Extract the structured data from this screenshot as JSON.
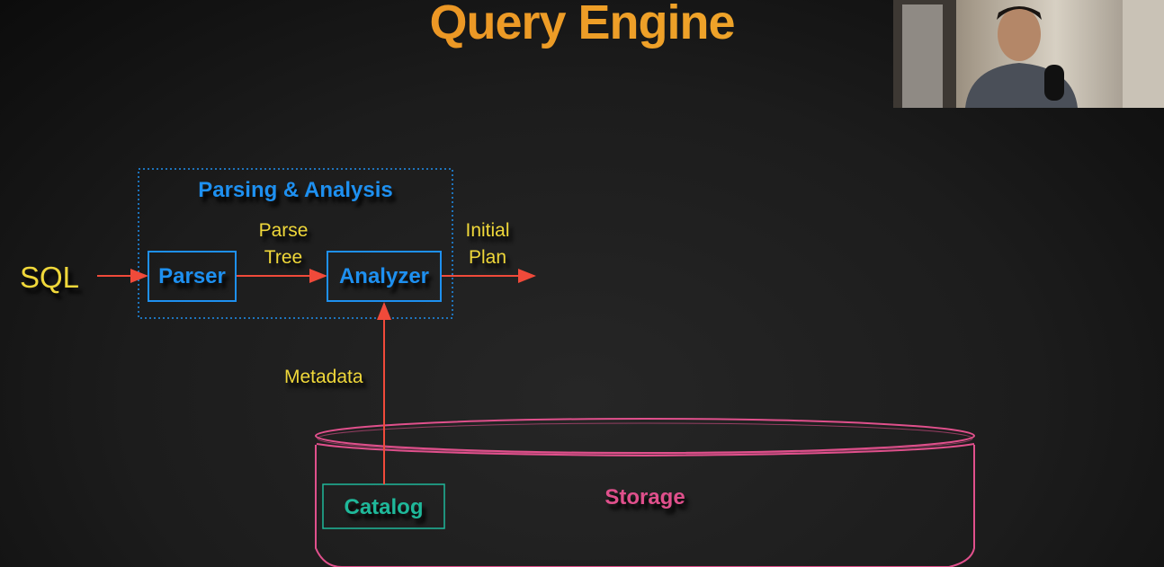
{
  "slide": {
    "title": "Query Engine",
    "group_label": "Parsing & Analysis",
    "input_label": "SQL",
    "parser_label": "Parser",
    "analyzer_label": "Analyzer",
    "edge_parse_tree": [
      "Parse",
      "Tree"
    ],
    "edge_initial_plan": [
      "Initial",
      "Plan"
    ],
    "edge_metadata": "Metadata",
    "catalog_label": "Catalog",
    "storage_label": "Storage"
  },
  "colors": {
    "title": "#eea02a",
    "yellow_text": "#f0d83a",
    "blue": "#1e90f0",
    "arrow": "#f04a3a",
    "storage": "#e0508c",
    "catalog": "#1fb89a"
  },
  "webcam": {
    "icon": "presenter-video"
  }
}
